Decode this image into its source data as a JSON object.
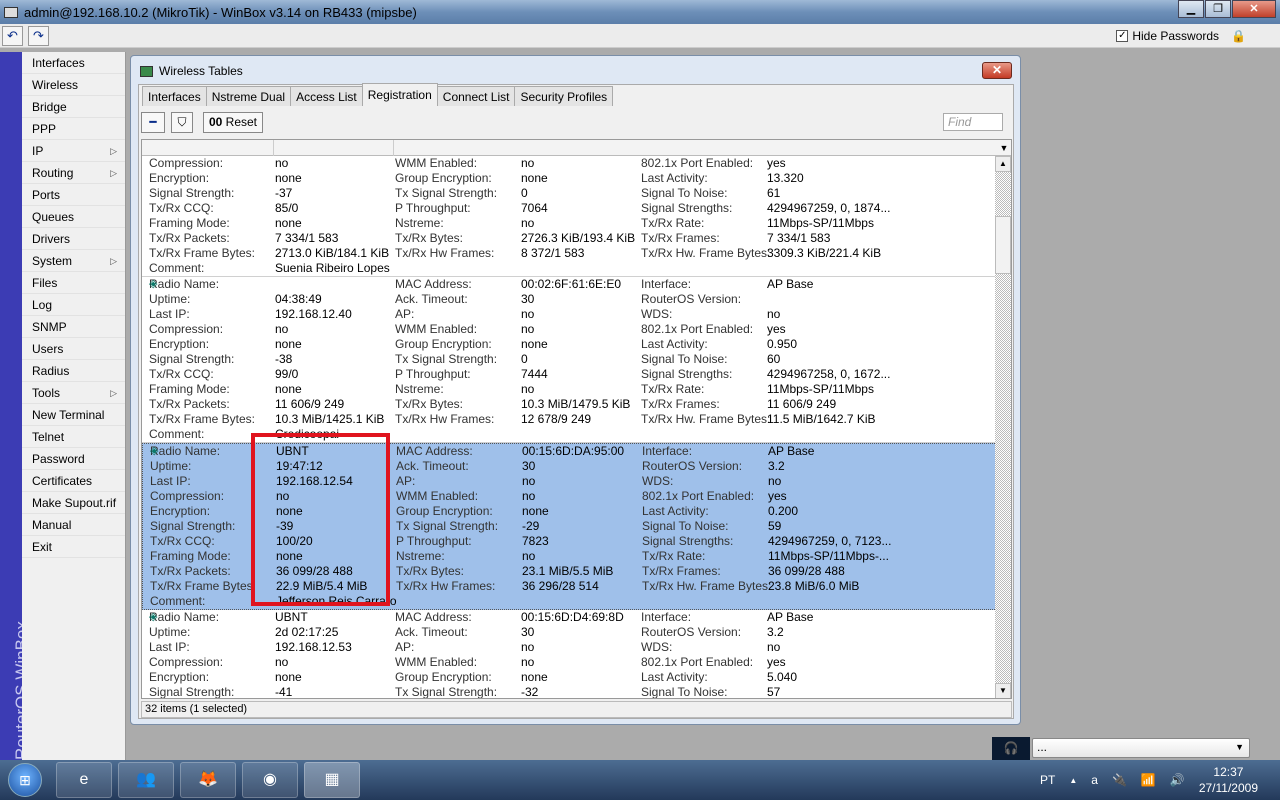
{
  "window": {
    "title": "admin@192.168.10.2 (MikroTik) - WinBox v3.14 on RB433 (mipsbe)",
    "min": "▁",
    "max": "❐",
    "close": "✕"
  },
  "toolbar": {
    "undo": "↶",
    "redo": "↷",
    "hide_passwords": "Hide Passwords",
    "hide_checked": "✓"
  },
  "brand": "RouterOS WinBox",
  "sidebar": [
    {
      "label": "Interfaces"
    },
    {
      "label": "Wireless"
    },
    {
      "label": "Bridge"
    },
    {
      "label": "PPP"
    },
    {
      "label": "IP",
      "sub": true
    },
    {
      "label": "Routing",
      "sub": true
    },
    {
      "label": "Ports"
    },
    {
      "label": "Queues"
    },
    {
      "label": "Drivers"
    },
    {
      "label": "System",
      "sub": true
    },
    {
      "label": "Files"
    },
    {
      "label": "Log"
    },
    {
      "label": "SNMP"
    },
    {
      "label": "Users"
    },
    {
      "label": "Radius"
    },
    {
      "label": "Tools",
      "sub": true
    },
    {
      "label": "New Terminal"
    },
    {
      "label": "Telnet"
    },
    {
      "label": "Password"
    },
    {
      "label": "Certificates"
    },
    {
      "label": "Make Supout.rif"
    },
    {
      "label": "Manual"
    },
    {
      "label": "Exit"
    }
  ],
  "dialog": {
    "title": "Wireless Tables",
    "close": "✕",
    "tabs": [
      "Interfaces",
      "Nstreme Dual",
      "Access List",
      "Registration",
      "Connect List",
      "Security Profiles"
    ],
    "active_tab": 3,
    "remove": "━",
    "filter": "⛉",
    "reset_icon": "00",
    "reset": "Reset",
    "find_placeholder": "Find",
    "status": "32 items (1 selected)",
    "records": [
      {
        "selected": false,
        "lines": [
          [
            "Compression:",
            "no",
            "WMM Enabled:",
            "no",
            "802.1x Port Enabled:",
            "yes"
          ],
          [
            "Encryption:",
            "none",
            "Group Encryption:",
            "none",
            "Last Activity:",
            "13.320"
          ],
          [
            "Signal Strength:",
            "-37",
            "Tx Signal Strength:",
            "0",
            "Signal To Noise:",
            "61"
          ],
          [
            "Tx/Rx CCQ:",
            "85/0",
            "P Throughput:",
            "7064",
            "Signal Strengths:",
            "4294967259, 0, 1874..."
          ],
          [
            "Framing Mode:",
            "none",
            "Nstreme:",
            "no",
            "Tx/Rx Rate:",
            "11Mbps-SP/11Mbps"
          ],
          [
            "Tx/Rx Packets:",
            "7 334/1 583",
            "Tx/Rx Bytes:",
            "2726.3 KiB/193.4 KiB",
            "Tx/Rx Frames:",
            "7 334/1 583"
          ],
          [
            "Tx/Rx Frame Bytes:",
            "2713.0 KiB/184.1 KiB",
            "Tx/Rx Hw Frames:",
            "8 372/1 583",
            "Tx/Rx Hw. Frame Bytes:",
            "3309.3 KiB/221.4 KiB"
          ],
          [
            "Comment:",
            "Suenia Ribeiro Lopes",
            "",
            "",
            "",
            ""
          ]
        ]
      },
      {
        "selected": false,
        "lines": [
          [
            "Radio Name:",
            "",
            "MAC Address:",
            "00:02:6F:61:6E:E0",
            "Interface:",
            "AP Base"
          ],
          [
            "Uptime:",
            "04:38:49",
            "Ack. Timeout:",
            "30",
            "RouterOS Version:",
            ""
          ],
          [
            "Last IP:",
            "192.168.12.40",
            "AP:",
            "no",
            "WDS:",
            "no"
          ],
          [
            "Compression:",
            "no",
            "WMM Enabled:",
            "no",
            "802.1x Port Enabled:",
            "yes"
          ],
          [
            "Encryption:",
            "none",
            "Group Encryption:",
            "none",
            "Last Activity:",
            "0.950"
          ],
          [
            "Signal Strength:",
            "-38",
            "Tx Signal Strength:",
            "0",
            "Signal To Noise:",
            "60"
          ],
          [
            "Tx/Rx CCQ:",
            "99/0",
            "P Throughput:",
            "7444",
            "Signal Strengths:",
            "4294967258, 0, 1672..."
          ],
          [
            "Framing Mode:",
            "none",
            "Nstreme:",
            "no",
            "Tx/Rx Rate:",
            "11Mbps-SP/11Mbps"
          ],
          [
            "Tx/Rx Packets:",
            "11 606/9 249",
            "Tx/Rx Bytes:",
            "10.3 MiB/1479.5 KiB",
            "Tx/Rx Frames:",
            "11 606/9 249"
          ],
          [
            "Tx/Rx Frame Bytes:",
            "10.3 MiB/1425.1 KiB",
            "Tx/Rx Hw Frames:",
            "12 678/9 249",
            "Tx/Rx Hw. Frame Bytes:",
            "11.5 MiB/1642.7 KiB"
          ],
          [
            "Comment:",
            "Credicoopai",
            "",
            "",
            "",
            ""
          ]
        ]
      },
      {
        "selected": true,
        "lines": [
          [
            "Radio Name:",
            "UBNT",
            "MAC Address:",
            "00:15:6D:DA:95:00",
            "Interface:",
            "AP Base"
          ],
          [
            "Uptime:",
            "19:47:12",
            "Ack. Timeout:",
            "30",
            "RouterOS Version:",
            "3.2"
          ],
          [
            "Last IP:",
            "192.168.12.54",
            "AP:",
            "no",
            "WDS:",
            "no"
          ],
          [
            "Compression:",
            "no",
            "WMM Enabled:",
            "no",
            "802.1x Port Enabled:",
            "yes"
          ],
          [
            "Encryption:",
            "none",
            "Group Encryption:",
            "none",
            "Last Activity:",
            "0.200"
          ],
          [
            "Signal Strength:",
            "-39",
            "Tx Signal Strength:",
            "-29",
            "Signal To Noise:",
            "59"
          ],
          [
            "Tx/Rx CCQ:",
            "100/20",
            "P Throughput:",
            "7823",
            "Signal Strengths:",
            "4294967259, 0, 7123..."
          ],
          [
            "Framing Mode:",
            "none",
            "Nstreme:",
            "no",
            "Tx/Rx Rate:",
            "11Mbps-SP/11Mbps-..."
          ],
          [
            "Tx/Rx Packets:",
            "36 099/28 488",
            "Tx/Rx Bytes:",
            "23.1 MiB/5.5 MiB",
            "Tx/Rx Frames:",
            "36 099/28 488"
          ],
          [
            "Tx/Rx Frame Bytes:",
            "22.9 MiB/5.4 MiB",
            "Tx/Rx Hw Frames:",
            "36 296/28 514",
            "Tx/Rx Hw. Frame Bytes:",
            "23.8 MiB/6.0 MiB"
          ],
          [
            "Comment:",
            "Jefferson Reis Carraro",
            "",
            "",
            "",
            ""
          ]
        ]
      },
      {
        "selected": false,
        "lines": [
          [
            "Radio Name:",
            "UBNT",
            "MAC Address:",
            "00:15:6D:D4:69:8D",
            "Interface:",
            "AP Base"
          ],
          [
            "Uptime:",
            "2d 02:17:25",
            "Ack. Timeout:",
            "30",
            "RouterOS Version:",
            "3.2"
          ],
          [
            "Last IP:",
            "192.168.12.53",
            "AP:",
            "no",
            "WDS:",
            "no"
          ],
          [
            "Compression:",
            "no",
            "WMM Enabled:",
            "no",
            "802.1x Port Enabled:",
            "yes"
          ],
          [
            "Encryption:",
            "none",
            "Group Encryption:",
            "none",
            "Last Activity:",
            "5.040"
          ],
          [
            "Signal Strength:",
            "-41",
            "Tx Signal Strength:",
            "-32",
            "Signal To Noise:",
            "57"
          ]
        ]
      }
    ]
  },
  "media": {
    "value": "...",
    "arrow": "▼",
    "icon": "🎧"
  },
  "taskbar": {
    "start": "⊞",
    "apps": [
      "e",
      "👥",
      "🦊",
      "◉",
      "▦"
    ],
    "lang": "PT",
    "tray_up": "▲",
    "tray_icons": [
      "a",
      "🔌",
      "📶",
      "🔊"
    ],
    "time": "12:37",
    "date": "27/11/2009"
  }
}
